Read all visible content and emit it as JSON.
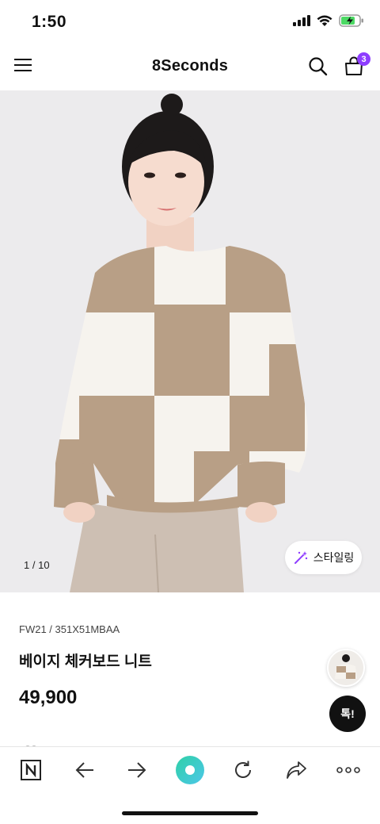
{
  "status_bar": {
    "time": "1:50"
  },
  "header": {
    "brand": "8Seconds",
    "cart_count": "3"
  },
  "gallery": {
    "counter_current": "1",
    "counter_total": "/ 10",
    "styling_label": "스타일링"
  },
  "product": {
    "code": "FW21 / 351X51MBAA",
    "name": "베이지 체커보드 니트",
    "price": "49,900"
  },
  "chat": {
    "label": "톡!"
  },
  "colors": {
    "accent": "#8e3dff",
    "sweater_beige": "#b89f86",
    "sweater_white": "#f6f3ee",
    "background": "#ecebed"
  },
  "toolbar": {
    "icons": [
      "naver-n-icon",
      "back-arrow-icon",
      "forward-arrow-icon",
      "green-dot-icon",
      "reload-icon",
      "share-icon",
      "more-icon"
    ]
  }
}
